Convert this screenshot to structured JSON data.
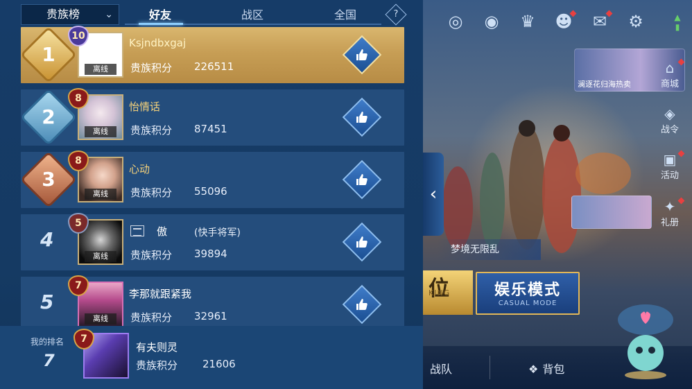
{
  "tabs": {
    "dropdown": "贵族榜",
    "items": [
      "好友",
      "战区",
      "全国"
    ],
    "active_index": 0
  },
  "leaderboard": [
    {
      "rank": "1",
      "vip": "10",
      "name": "Ksjndbxgaj",
      "name_extra": "",
      "status": "离线",
      "score_label": "贵族积分",
      "score": "226511",
      "name_color": "#fff3c4"
    },
    {
      "rank": "2",
      "vip": "8",
      "name": "怡情话",
      "name_extra": "",
      "status": "离线",
      "score_label": "贵族积分",
      "score": "87451",
      "name_color": "#f6d27a"
    },
    {
      "rank": "3",
      "vip": "8",
      "name": "心动",
      "name_extra": "",
      "status": "离线",
      "score_label": "贵族积分",
      "score": "55096",
      "name_color": "#f6d27a"
    },
    {
      "rank": "4",
      "vip": "5",
      "name": "傲",
      "name_extra": "(快手将军)",
      "status": "离线",
      "score_label": "贵族积分",
      "score": "39894",
      "name_color": "#ffffff"
    },
    {
      "rank": "5",
      "vip": "7",
      "name": "李那就跟紧我",
      "name_extra": "",
      "status": "离线",
      "score_label": "贵族积分",
      "score": "32961",
      "name_color": "#ffffff"
    }
  ],
  "my_rank": {
    "label": "我的排名",
    "rank": "7",
    "vip": "7",
    "name": "有夫则灵",
    "score_label": "贵族积分",
    "score": "21606"
  },
  "lobby": {
    "top_icons": [
      "target-icon",
      "eye-icon",
      "trophy-icon",
      "friends-icon",
      "mail-icon",
      "gear-icon"
    ],
    "promo_caption": "澜逐花归海热卖",
    "side_buttons": [
      "商城",
      "战令",
      "活动",
      "礼册"
    ],
    "mode_banner": "梦境无限乱",
    "ranked_text": "位",
    "ranked_sub": "KING",
    "casual_title": "娱乐模式",
    "casual_sub": "CASUAL MODE",
    "bottom_items": [
      "战队",
      "背包"
    ]
  },
  "colors": {
    "panel_bg": "#163c68",
    "row_bg": "#244d7c",
    "first_row_gold": "#c79e55",
    "tab_highlight": "#8fd0ff",
    "name_gold": "#f6d27a"
  }
}
